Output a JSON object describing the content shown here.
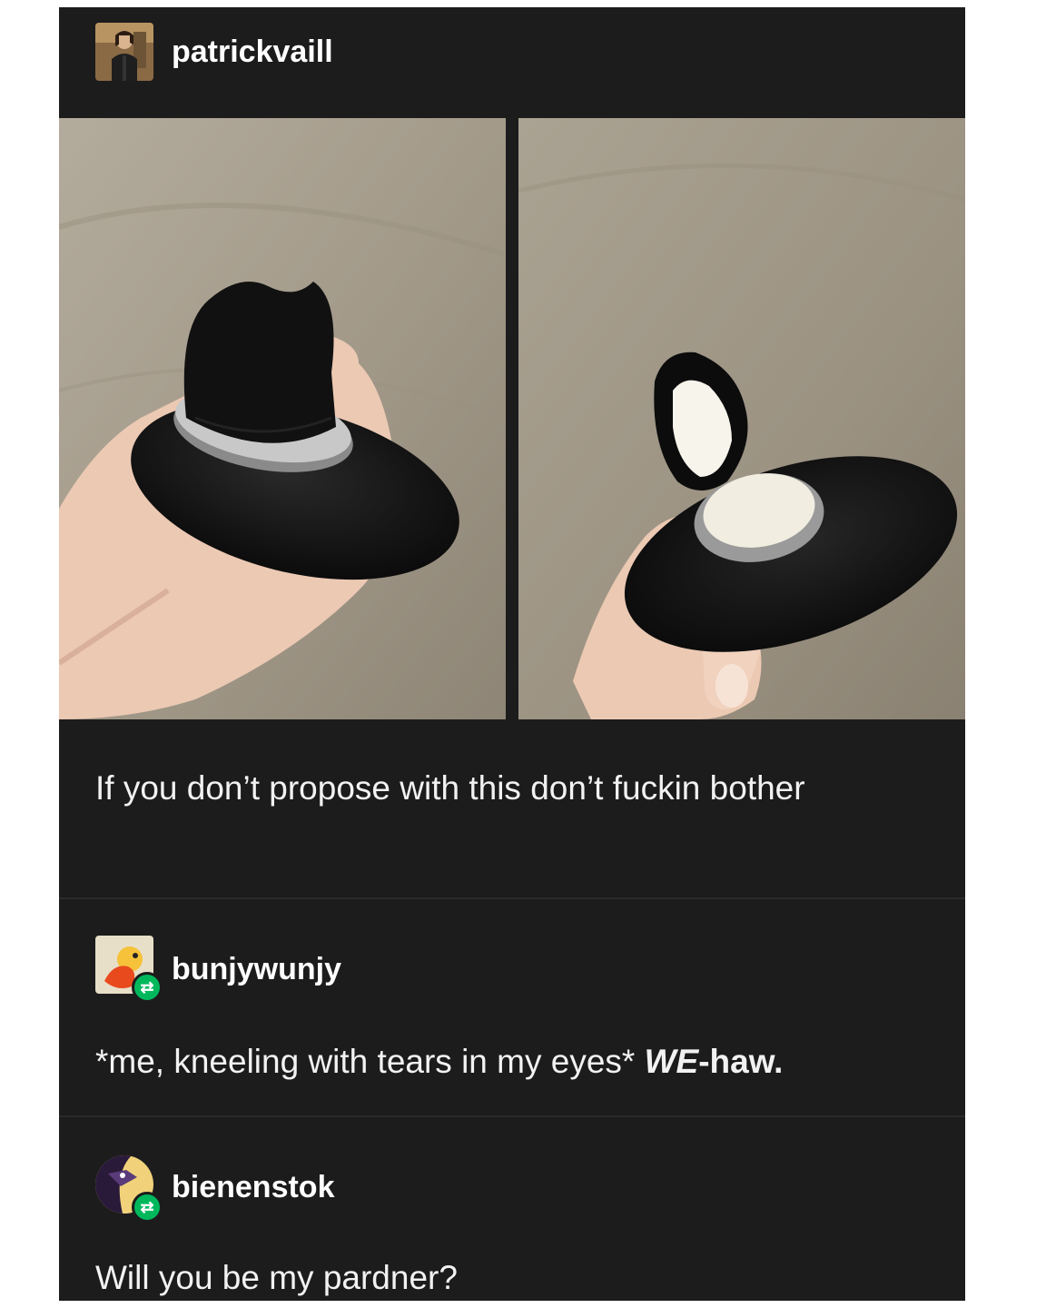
{
  "original_post": {
    "username": "patrickvaill",
    "caption": "If you don’t propose with this don’t fuckin bother"
  },
  "reblogs": [
    {
      "username": "bunjywunjy",
      "text_plain": "*me, kneeling with tears in my eyes* ",
      "text_emph_italic": "WE",
      "text_emph_bold": "-haw."
    },
    {
      "username": "bienenstok",
      "text": "Will you be my pardner?"
    }
  ],
  "icons": {
    "reblog_badge": "reblog-icon"
  },
  "colors": {
    "post_bg": "#1c1c1c",
    "text": "#f2f2f2",
    "reblog_green": "#00b85c"
  }
}
